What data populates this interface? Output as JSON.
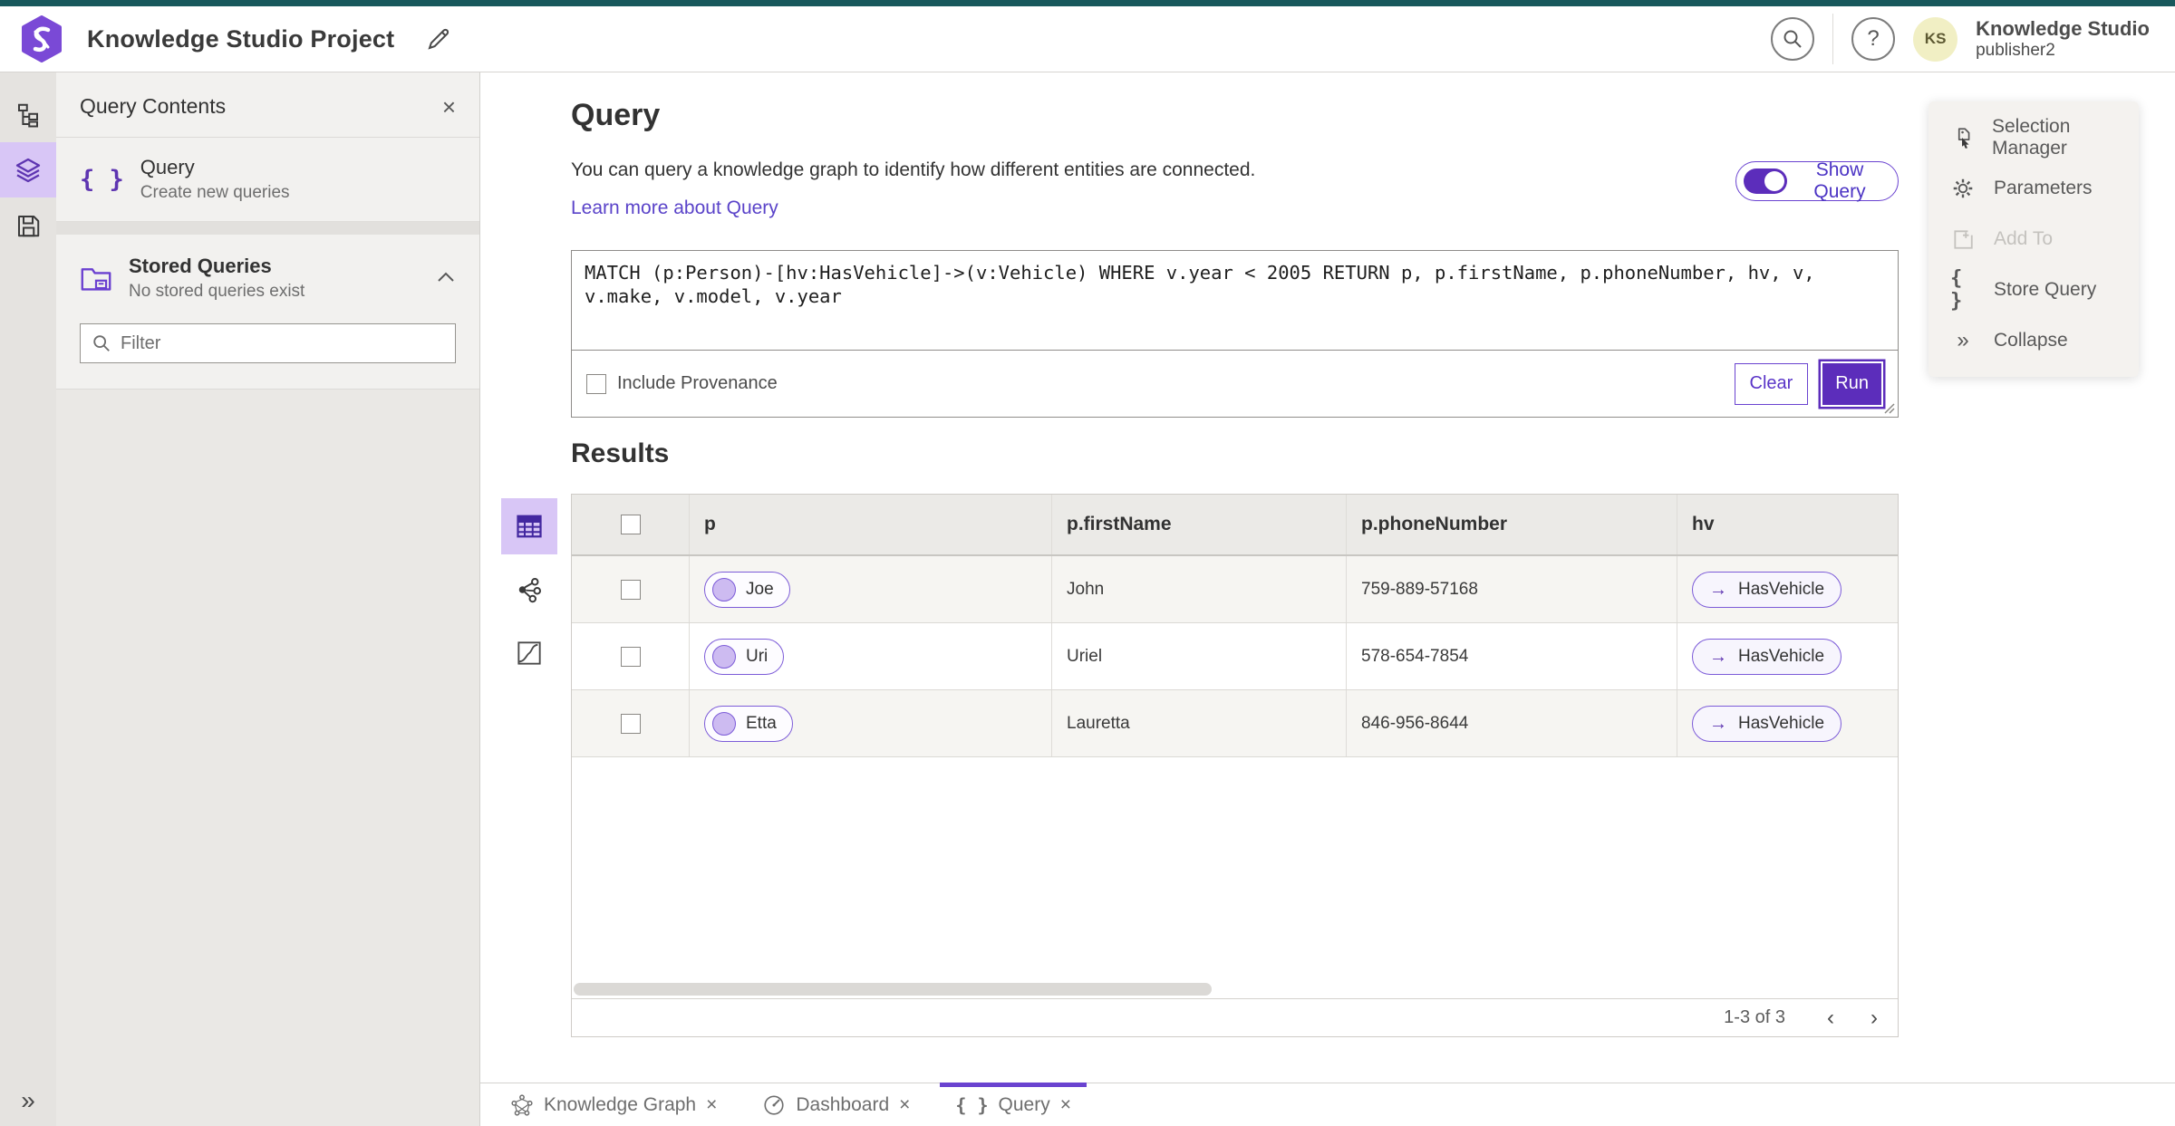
{
  "topbar": {
    "title": "Knowledge Studio Project",
    "avatar_initials": "KS",
    "account_name": "Knowledge Studio",
    "account_user": "publisher2",
    "help_glyph": "?"
  },
  "sidebar": {
    "title": "Query Contents",
    "close_glyph": "×",
    "query_item": {
      "icon_glyph": "{ }",
      "label": "Query",
      "description": "Create new queries"
    },
    "stored": {
      "label": "Stored Queries",
      "description": "No stored queries exist"
    },
    "filter": {
      "placeholder": "Filter"
    },
    "rail_collapse_glyph": "»"
  },
  "query": {
    "heading": "Query",
    "description": "You can query a knowledge graph to identify how different entities are connected.",
    "learn_more_link": "Learn more about Query",
    "show_query_label": "Show Query",
    "statement": "MATCH (p:Person)-[hv:HasVehicle]->(v:Vehicle) WHERE v.year < 2005 RETURN p, p.firstName, p.phoneNumber, hv, v, v.make, v.model, v.year",
    "include_provenance_label": "Include Provenance",
    "clear_button": "Clear",
    "run_button": "Run"
  },
  "results": {
    "heading": "Results",
    "columns": [
      "p",
      "p.firstName",
      "p.phoneNumber",
      "hv"
    ],
    "rows": [
      {
        "p": "Joe",
        "firstName": "John",
        "phoneNumber": "759-889-57168",
        "hv": "HasVehicle"
      },
      {
        "p": "Uri",
        "firstName": "Uriel",
        "phoneNumber": "578-654-7854",
        "hv": "HasVehicle"
      },
      {
        "p": "Etta",
        "firstName": "Lauretta",
        "phoneNumber": "846-956-8644",
        "hv": "HasVehicle"
      }
    ],
    "hv_arrow_glyph": "→",
    "pagination": {
      "range_label": "1-3 of 3",
      "prev_glyph": "‹",
      "next_glyph": "›"
    }
  },
  "actions_panel": {
    "items": [
      {
        "label": "Selection Manager"
      },
      {
        "label": "Parameters"
      },
      {
        "label": "Add To"
      },
      {
        "label": "Store Query",
        "icon_glyph": "{ }"
      },
      {
        "label": "Collapse",
        "icon_glyph": "»"
      }
    ]
  },
  "tabs": [
    {
      "label": "Knowledge Graph",
      "close_glyph": "×"
    },
    {
      "label": "Dashboard",
      "close_glyph": "×"
    },
    {
      "label": "Query",
      "icon_glyph": "{ }",
      "close_glyph": "×"
    }
  ],
  "colors": {
    "accent": "#6a43d0",
    "accent_deep": "#5e35b1",
    "run_button_bg": "#5c2dbb",
    "top_strip": "#18585c",
    "avatar_bg": "#f1efc4",
    "active_rail_bg": "#d8c6f6"
  }
}
